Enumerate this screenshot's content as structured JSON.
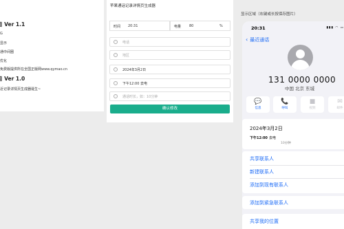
{
  "changelog": {
    "v11": {
      "title": "Ver 1.1",
      "lines": [
        "G",
        "显示",
        "通中间圈",
        "优化",
        "免费版提供所在全国正版网www.qymao.cn"
      ]
    },
    "v10": {
      "title": "Ver 1.0",
      "lines": [
        "近记录详情页生成器诞生~"
      ]
    }
  },
  "form": {
    "title": "苹果通话记录详情页生成器",
    "time_label": "时间",
    "time_value": "20:31",
    "battery_label": "电量",
    "battery_value": "80",
    "battery_unit": "%",
    "fields": [
      {
        "icon": "phone-icon",
        "placeholder": "电话",
        "value": ""
      },
      {
        "icon": "location-icon",
        "placeholder": "地区",
        "value": ""
      },
      {
        "icon": "calendar-icon",
        "placeholder": "",
        "value": "2024年3月2日"
      },
      {
        "icon": "clock-icon",
        "placeholder": "",
        "value": "下午12:00   去电"
      },
      {
        "icon": "duration-icon",
        "placeholder": "通话时长，如：10分钟",
        "value": ""
      }
    ],
    "confirm_label": "确认修改"
  },
  "preview": {
    "label": "显示区域（右键或长按保存图片）",
    "status_time": "20:31",
    "status_icons": "▮▮▮ ◠ ▭",
    "back_label": "最近通话",
    "number": "131 0000 0000",
    "region": "中国 北京 东城",
    "actions": [
      {
        "icon": "message-icon",
        "glyph": "💬",
        "label": "信息",
        "enabled": true
      },
      {
        "icon": "call-icon",
        "glyph": "📞",
        "label": "呼叫",
        "enabled": true
      },
      {
        "icon": "video-icon",
        "glyph": "■",
        "label": "视频",
        "enabled": false
      },
      {
        "icon": "mail-icon",
        "glyph": "✉",
        "label": "邮件",
        "enabled": false
      }
    ],
    "call": {
      "date": "2024年3月2日",
      "time": "下午12:00",
      "type": "去电",
      "duration": "10分钟"
    },
    "links": [
      "共享联系人",
      "新建联系人",
      "添加到现有联系人",
      "添加到紧急联系人",
      "共享我的位置"
    ]
  },
  "colors": {
    "accent": "#1e6cf6",
    "confirm": "#1aad8c"
  }
}
